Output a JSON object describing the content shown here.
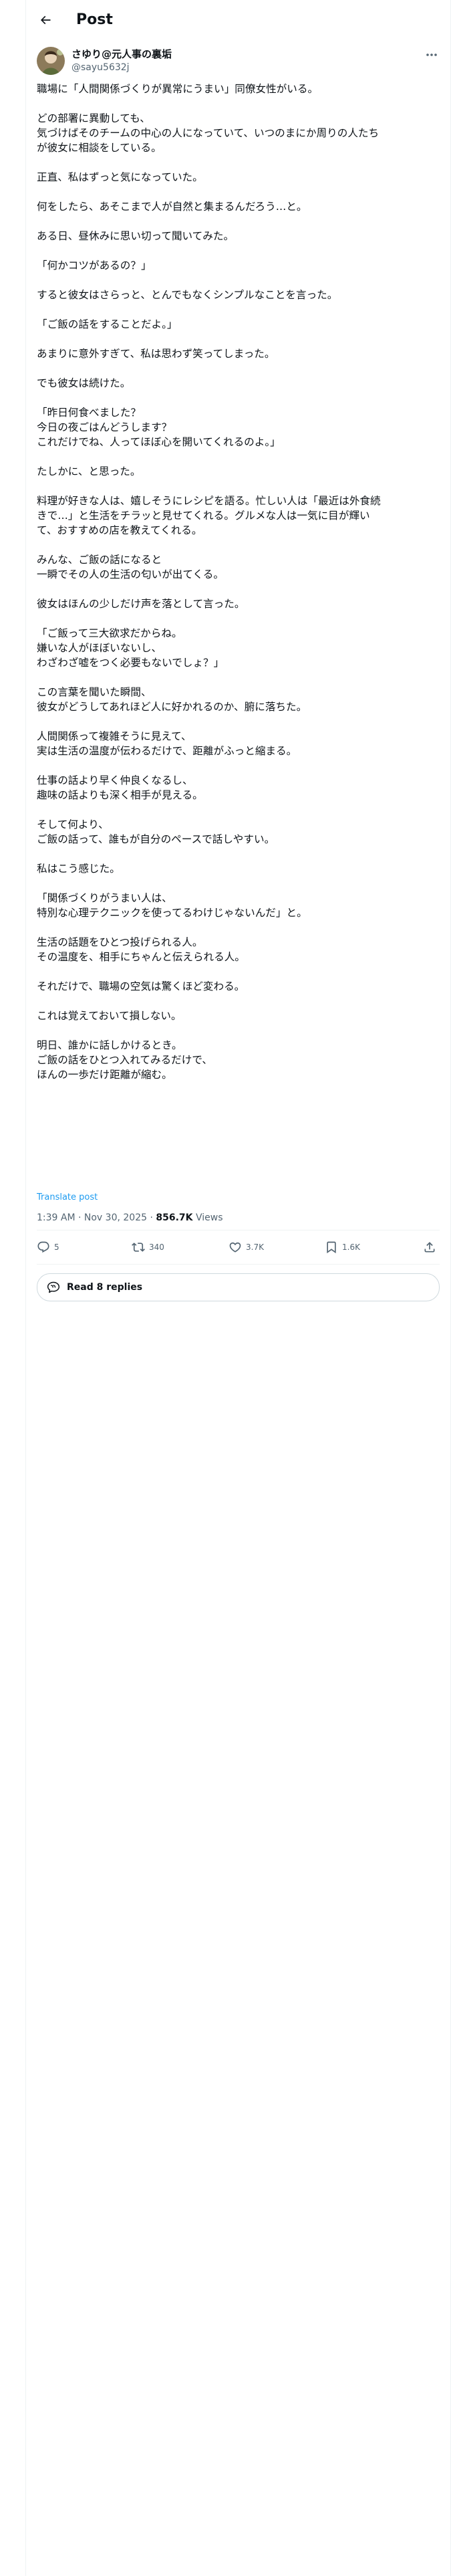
{
  "header": {
    "title": "Post"
  },
  "author": {
    "display_name": "さゆり@元人事の裏垢",
    "handle": "@sayu5632j"
  },
  "tweet": {
    "paragraphs": [
      "職場に「人間関係づくりが異常にうまい」同僚女性がいる。",
      "どの部署に異動しても、\n気づけばそのチームの中心の人になっていて、いつのまにか周りの人たち\nが彼女に相談をしている。",
      "正直、私はずっと気になっていた。",
      "何をしたら、あそこまで人が自然と集まるんだろう…と。",
      "ある日、昼休みに思い切って聞いてみた。",
      "「何かコツがあるの？」",
      "すると彼女はさらっと、とんでもなくシンプルなことを言った。",
      "「ご飯の話をすることだよ。」",
      "あまりに意外すぎて、私は思わず笑ってしまった。",
      "でも彼女は続けた。",
      "「昨日何食べました？\n今日の夜ごはんどうします？\nこれだけでね、人ってほぼ心を開いてくれるのよ。」",
      "たしかに、と思った。",
      "料理が好きな人は、嬉しそうにレシピを語る。忙しい人は「最近は外食続\nきで…」と生活をチラッと見せてくれる。グルメな人は一気に目が輝い\nて、おすすめの店を教えてくれる。",
      "みんな、ご飯の話になると\n一瞬でその人の生活の匂いが出てくる。",
      "彼女はほんの少しだけ声を落として言った。",
      "「ご飯って三大欲求だからね。\n嫌いな人がほぼいないし、\nわざわざ嘘をつく必要もないでしょ？」",
      "この言葉を聞いた瞬間、\n彼女がどうしてあれほど人に好かれるのか、腑に落ちた。",
      "人間関係って複雑そうに見えて、\n実は生活の温度が伝わるだけで、距離がふっと縮まる。",
      "仕事の話より早く仲良くなるし、\n趣味の話よりも深く相手が見える。",
      "そして何より、\nご飯の話って、誰もが自分のペースで話しやすい。",
      "私はこう感じた。",
      "「関係づくりがうまい人は、\n特別な心理テクニックを使ってるわけじゃないんだ」と。",
      "生活の話題をひとつ投げられる人。\nその温度を、相手にちゃんと伝えられる人。",
      "それだけで、職場の空気は驚くほど変わる。",
      "これは覚えておいて損しない。",
      "明日、誰かに話しかけるとき。\nご飯の話をひとつ入れてみるだけで、\nほんの一歩だけ距離が縮む。"
    ],
    "translate_label": "Translate post",
    "timestamp": "1:39 AM · Nov 30, 2025",
    "separator": " · ",
    "views_count": "856.7K",
    "views_label": " Views"
  },
  "actions": {
    "replies": "5",
    "reposts": "340",
    "likes": "3.7K",
    "bookmarks": "1.6K"
  },
  "read_replies_label": "Read 8 replies",
  "colors": {
    "text": "#0f1419",
    "secondary": "#536471",
    "link": "#1d9bf0",
    "border": "#eff3f4"
  }
}
